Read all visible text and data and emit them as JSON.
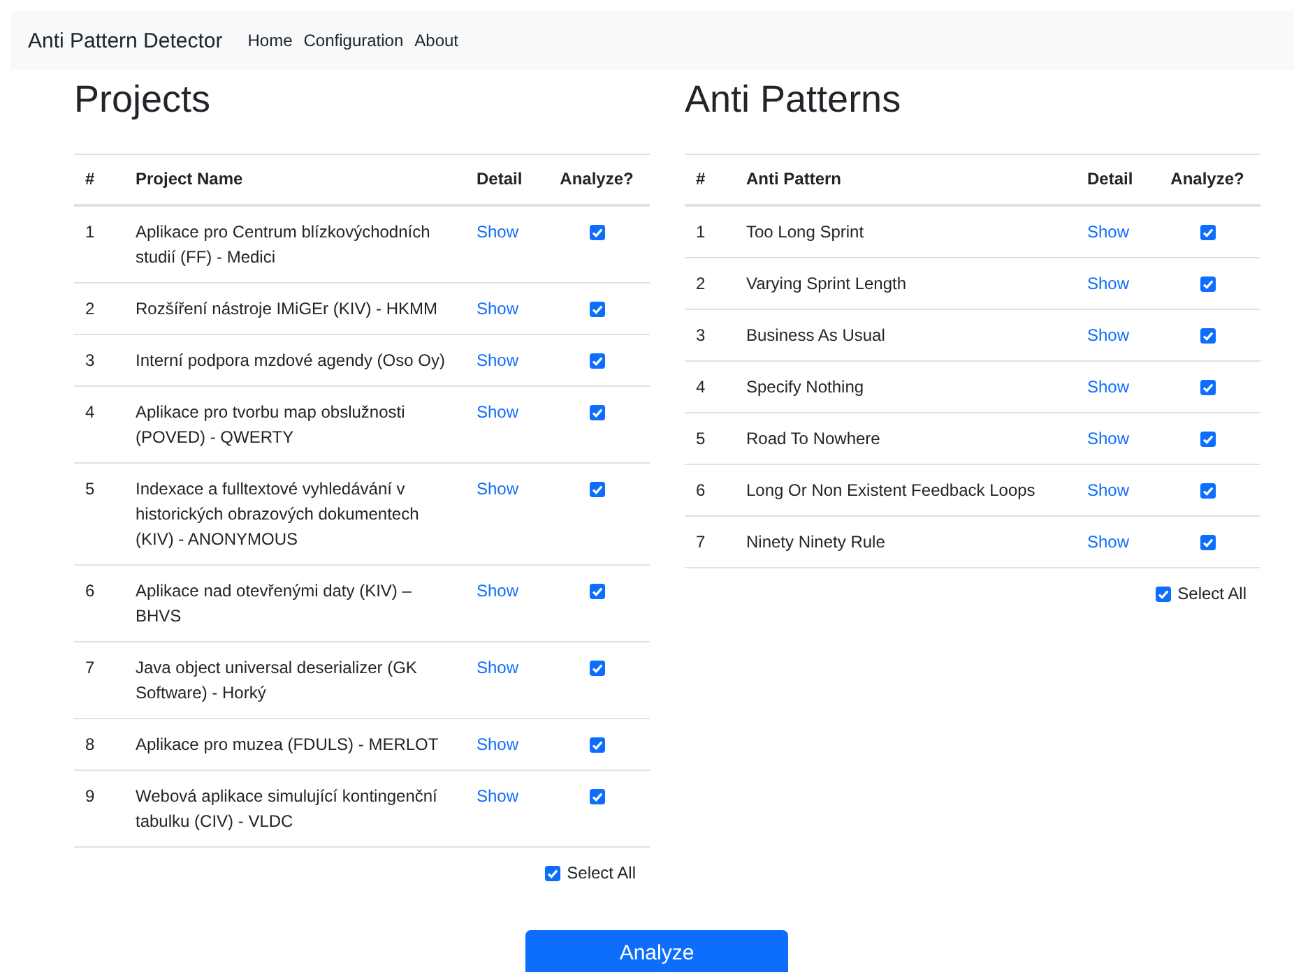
{
  "navbar": {
    "brand": "Anti Pattern Detector",
    "links": [
      "Home",
      "Configuration",
      "About"
    ]
  },
  "projects": {
    "title": "Projects",
    "columns": [
      "#",
      "Project Name",
      "Detail",
      "Analyze?"
    ],
    "rows": [
      {
        "number": "1",
        "name": "Aplikace pro Centrum blízkovýchodních studií (FF) - Medici",
        "detail": "Show",
        "checked": true
      },
      {
        "number": "2",
        "name": "Rozšíření nástroje IMiGEr (KIV) - HKMM",
        "detail": "Show",
        "checked": true
      },
      {
        "number": "3",
        "name": "Interní podpora mzdové agendy (Oso Oy)",
        "detail": "Show",
        "checked": true
      },
      {
        "number": "4",
        "name": "Aplikace pro tvorbu map obslužnosti (POVED) - QWERTY",
        "detail": "Show",
        "checked": true
      },
      {
        "number": "5",
        "name": "Indexace a fulltextové vyhledávání v historických obrazových dokumentech (KIV) - ANONYMOUS",
        "detail": "Show",
        "checked": true
      },
      {
        "number": "6",
        "name": "Aplikace nad otevřenými daty (KIV) – BHVS",
        "detail": "Show",
        "checked": true
      },
      {
        "number": "7",
        "name": "Java object universal deserializer (GK Software) - Horký",
        "detail": "Show",
        "checked": true
      },
      {
        "number": "8",
        "name": "Aplikace pro muzea (FDULS) - MERLOT",
        "detail": "Show",
        "checked": true
      },
      {
        "number": "9",
        "name": "Webová aplikace simulující kontingenční tabulku (CIV) - VLDC",
        "detail": "Show",
        "checked": true
      }
    ],
    "select_all": {
      "label": "Select All",
      "checked": true
    }
  },
  "anti_patterns": {
    "title": "Anti Patterns",
    "columns": [
      "#",
      "Anti Pattern",
      "Detail",
      "Analyze?"
    ],
    "rows": [
      {
        "number": "1",
        "name": "Too Long Sprint",
        "detail": "Show",
        "checked": true
      },
      {
        "number": "2",
        "name": "Varying Sprint Length",
        "detail": "Show",
        "checked": true
      },
      {
        "number": "3",
        "name": "Business As Usual",
        "detail": "Show",
        "checked": true
      },
      {
        "number": "4",
        "name": "Specify Nothing",
        "detail": "Show",
        "checked": true
      },
      {
        "number": "5",
        "name": "Road To Nowhere",
        "detail": "Show",
        "checked": true
      },
      {
        "number": "6",
        "name": "Long Or Non Existent Feedback Loops",
        "detail": "Show",
        "checked": true
      },
      {
        "number": "7",
        "name": "Ninety Ninety Rule",
        "detail": "Show",
        "checked": true
      }
    ],
    "select_all": {
      "label": "Select All",
      "checked": true
    }
  },
  "analyze_button": "Analyze"
}
